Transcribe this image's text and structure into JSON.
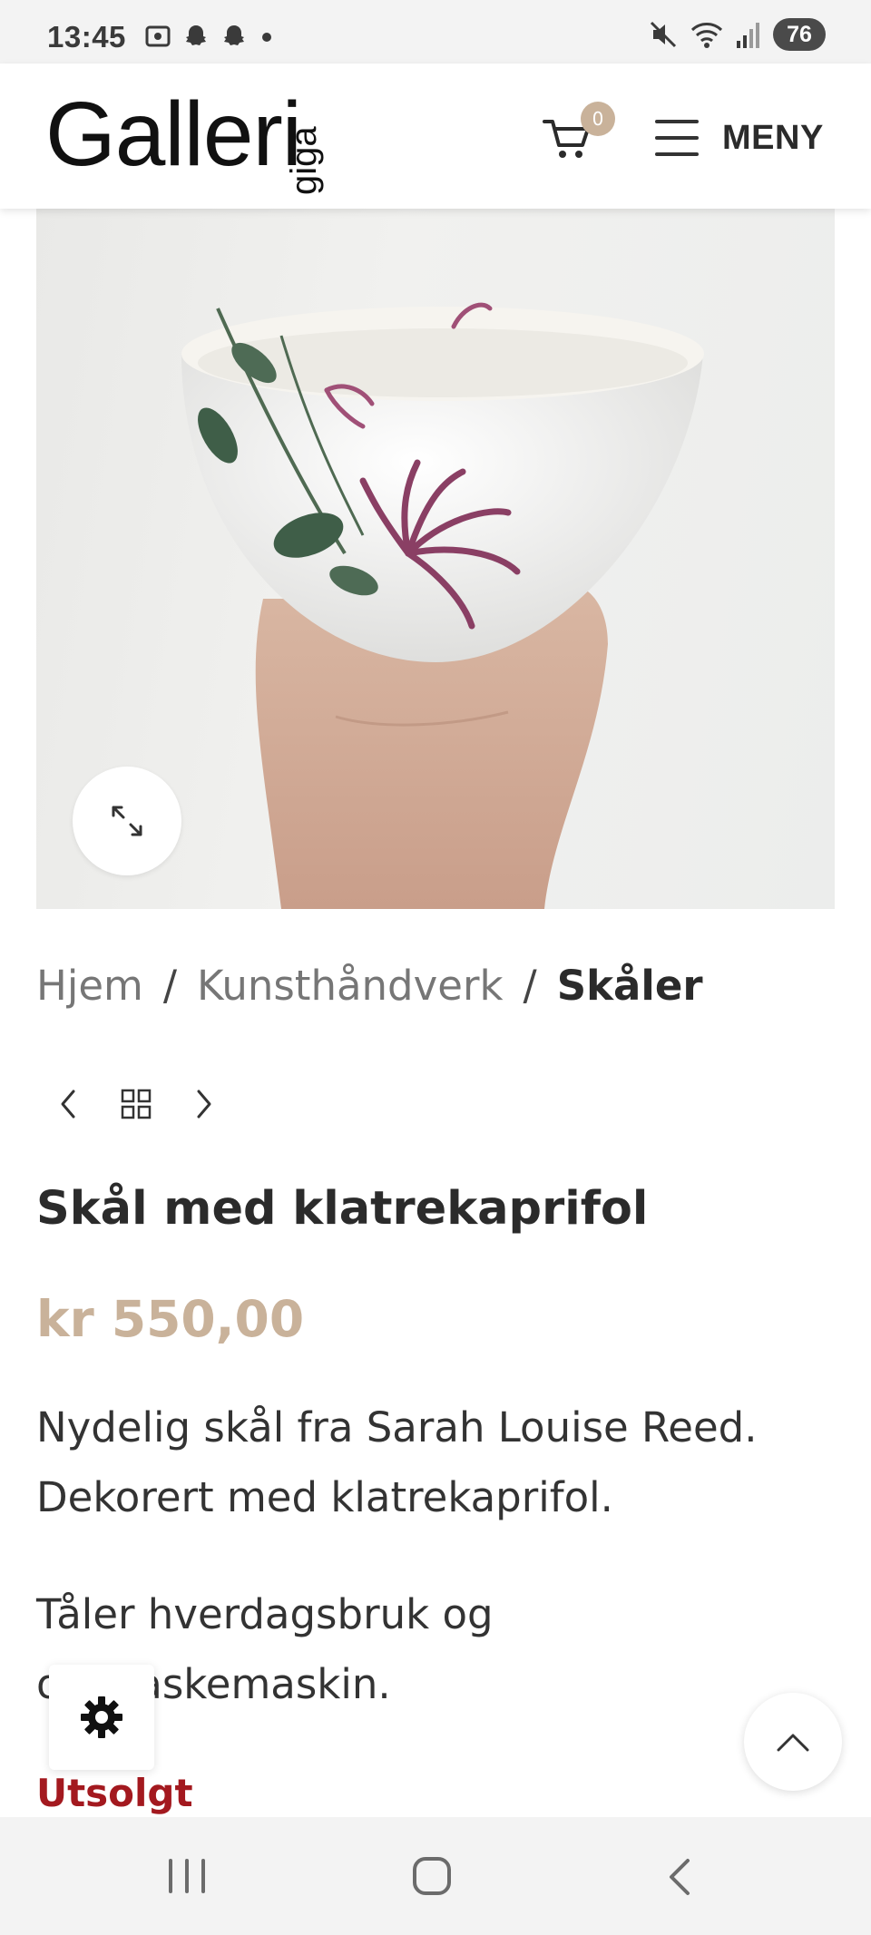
{
  "status_bar": {
    "time": "13:45",
    "battery": "76",
    "icons": [
      "screenshot-icon",
      "snapchat-icon",
      "snapchat-icon",
      "dot-icon",
      "mute-icon",
      "wifi-icon",
      "signal-icon"
    ]
  },
  "header": {
    "logo_main": "Galleri",
    "logo_sub": "giga",
    "cart_count": "0",
    "menu_label": "MENY"
  },
  "breadcrumb": {
    "items": [
      "Hjem",
      "Kunsthåndverk",
      "Skåler"
    ],
    "separator": "/"
  },
  "product": {
    "title": "Skål med klatrekaprifol",
    "price": "kr 550,00",
    "description_1": "Nydelig skål fra Sarah Louise Reed. Dekorert med klatrekaprifol.",
    "description_2": "Tåler hverdagsbruk og oppvaskemaskin.",
    "stock_status": "Utsolgt"
  },
  "colors": {
    "accent": "#c9b29a",
    "soldout": "#a3191f",
    "text": "#2b2b2b"
  }
}
